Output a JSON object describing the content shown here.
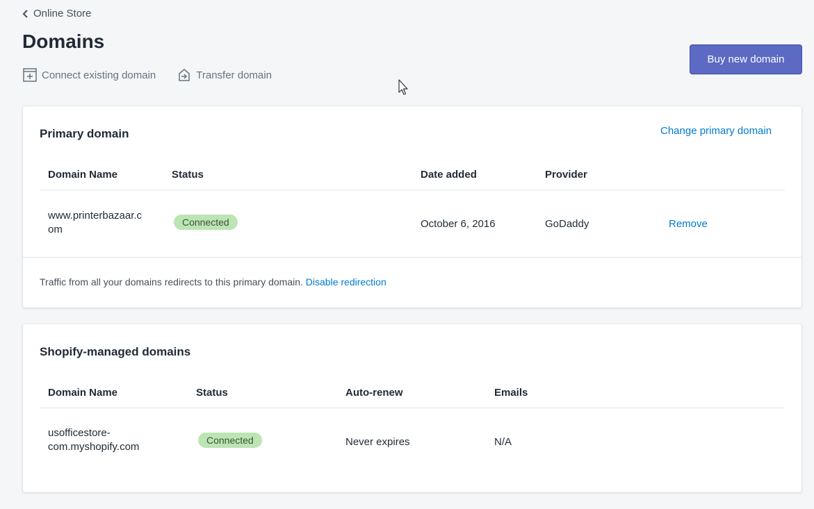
{
  "breadcrumb": {
    "label": "Online Store"
  },
  "page": {
    "title": "Domains"
  },
  "actions": {
    "connect_label": "Connect existing domain",
    "transfer_label": "Transfer domain",
    "buy_label": "Buy new domain"
  },
  "primary_domain": {
    "title": "Primary domain",
    "change_link": "Change primary domain",
    "columns": [
      "Domain Name",
      "Status",
      "Date added",
      "Provider"
    ],
    "row": {
      "domain_line1": "www.printerbazaar.c",
      "domain_line2": "om",
      "status": "Connected",
      "date_added": "October 6, 2016",
      "provider": "GoDaddy",
      "remove": "Remove"
    },
    "footer_text": "Traffic from all your domains redirects to this primary domain.",
    "footer_link": "Disable redirection"
  },
  "managed_domains": {
    "title": "Shopify-managed domains",
    "columns": [
      "Domain Name",
      "Status",
      "Auto-renew",
      "Emails"
    ],
    "row": {
      "domain_line1": "usofficestore-",
      "domain_line2": "com.myshopify.com",
      "status": "Connected",
      "auto_renew": "Never expires",
      "emails": "N/A"
    }
  },
  "colors": {
    "accent": "#5c6ac4",
    "link": "#007ace",
    "badge_success": "#bbe5b3",
    "background": "#f4f6f8"
  },
  "icons": {
    "breadcrumb": "chevron-left-icon",
    "connect": "connect-domain-icon",
    "transfer": "transfer-domain-icon"
  }
}
